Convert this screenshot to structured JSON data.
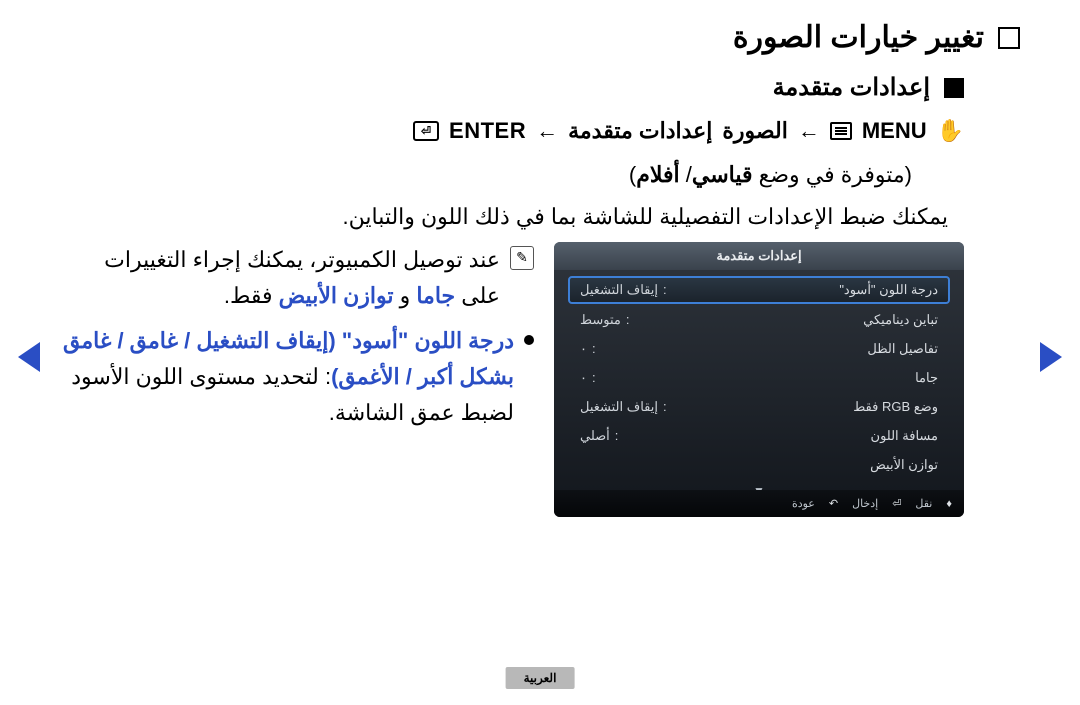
{
  "page": {
    "title": "تغيير خيارات الصورة",
    "subtitle": "إعدادات متقدمة",
    "path": {
      "enter": "ENTER",
      "to1": "←",
      "seg3": "إعدادات متقدمة",
      "seg2": "الصورة",
      "to2": "←",
      "menu": "MENU"
    },
    "availability": {
      "prefix": "(متوفرة في وضع ",
      "mode1": "قياسي",
      "sep": "/ ",
      "mode2": "أفلام",
      "suffix": ")"
    },
    "desc": "يمكنك ضبط الإعدادات التفصيلية للشاشة بما في ذلك اللون والتباين.",
    "note": {
      "line1": "عند توصيل الكمبيوتر، يمكنك إجراء التغييرات",
      "line2a": "على ",
      "gamma": "جاما",
      "line2b": " و ",
      "wb": "توازن الأبيض",
      "line2c": " فقط."
    },
    "bullet": {
      "main": "درجة اللون \"أسود\" (إيقاف التشغيل / غامق / غامق بشكل أكبر / الأغمق)",
      "tail": ": لتحديد مستوى اللون الأسود لضبط عمق الشاشة."
    }
  },
  "osd": {
    "title": "إعدادات متقدمة",
    "items": [
      {
        "label": "درجة اللون \"أسود\"",
        "value": "إيقاف التشغيل"
      },
      {
        "label": "تباين ديناميكي",
        "value": "متوسط"
      },
      {
        "label": "تفاصيل الظل",
        "value": "٠"
      },
      {
        "label": "جاما",
        "value": "٠"
      },
      {
        "label": "وضع RGB فقط",
        "value": "إيقاف التشغيل"
      },
      {
        "label": "مسافة اللون",
        "value": "أصلي"
      },
      {
        "label": "توازن الأبيض",
        "value": ""
      }
    ],
    "footer": {
      "move": "نقل",
      "enter": "إدخال",
      "return": "عودة"
    }
  },
  "lang": "العربية"
}
